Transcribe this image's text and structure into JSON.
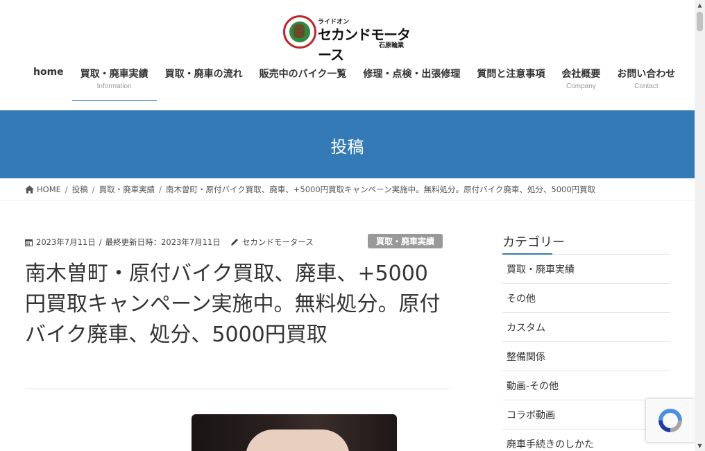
{
  "header": {
    "logo": {
      "small_text": "ライドオン",
      "main_text": "セカンドモータース",
      "sub_text": "石原輪業"
    },
    "nav": [
      {
        "label": "home",
        "sub": ""
      },
      {
        "label": "買取・廃車実績",
        "sub": "Information"
      },
      {
        "label": "買取・廃車の流れ",
        "sub": ""
      },
      {
        "label": "販売中のバイク一覧",
        "sub": ""
      },
      {
        "label": "修理・点検・出張修理",
        "sub": ""
      },
      {
        "label": "質問と注意事項",
        "sub": ""
      },
      {
        "label": "会社概要",
        "sub": "Company"
      },
      {
        "label": "お問い合わせ",
        "sub": "Contact"
      }
    ],
    "accent_color": "#337ab7"
  },
  "banner": {
    "title": "投稿"
  },
  "breadcrumb": {
    "home": "HOME",
    "items": [
      "投稿",
      "買取・廃車実績",
      "南木曽町・原付バイク買取、廃車、+5000円買取キャンペーン実施中。無料処分。原付バイク廃車、処分、5000円買取"
    ],
    "separator": "/"
  },
  "post": {
    "published": "2023年7月11日",
    "updated_label": "最終更新日時：",
    "updated": "2023年7月11日",
    "author": "セカンドモータース",
    "category": "買取・廃車実績",
    "title": "南木曽町・原付バイク買取、廃車、+5000円買取キャンペーン実施中。無料処分。原付バイク廃車、処分、5000円買取"
  },
  "sidebar": {
    "title": "カテゴリー",
    "categories": [
      "買取・廃車実績",
      "その他",
      "カスタム",
      "整備関係",
      "動画-その他",
      "コラボ動画",
      "廃車手続きのしかた"
    ]
  },
  "icons": {
    "breadcrumb_home": "home-icon",
    "meta_date": "calendar-icon",
    "meta_author": "pencil-icon",
    "recaptcha": "recaptcha-icon"
  }
}
